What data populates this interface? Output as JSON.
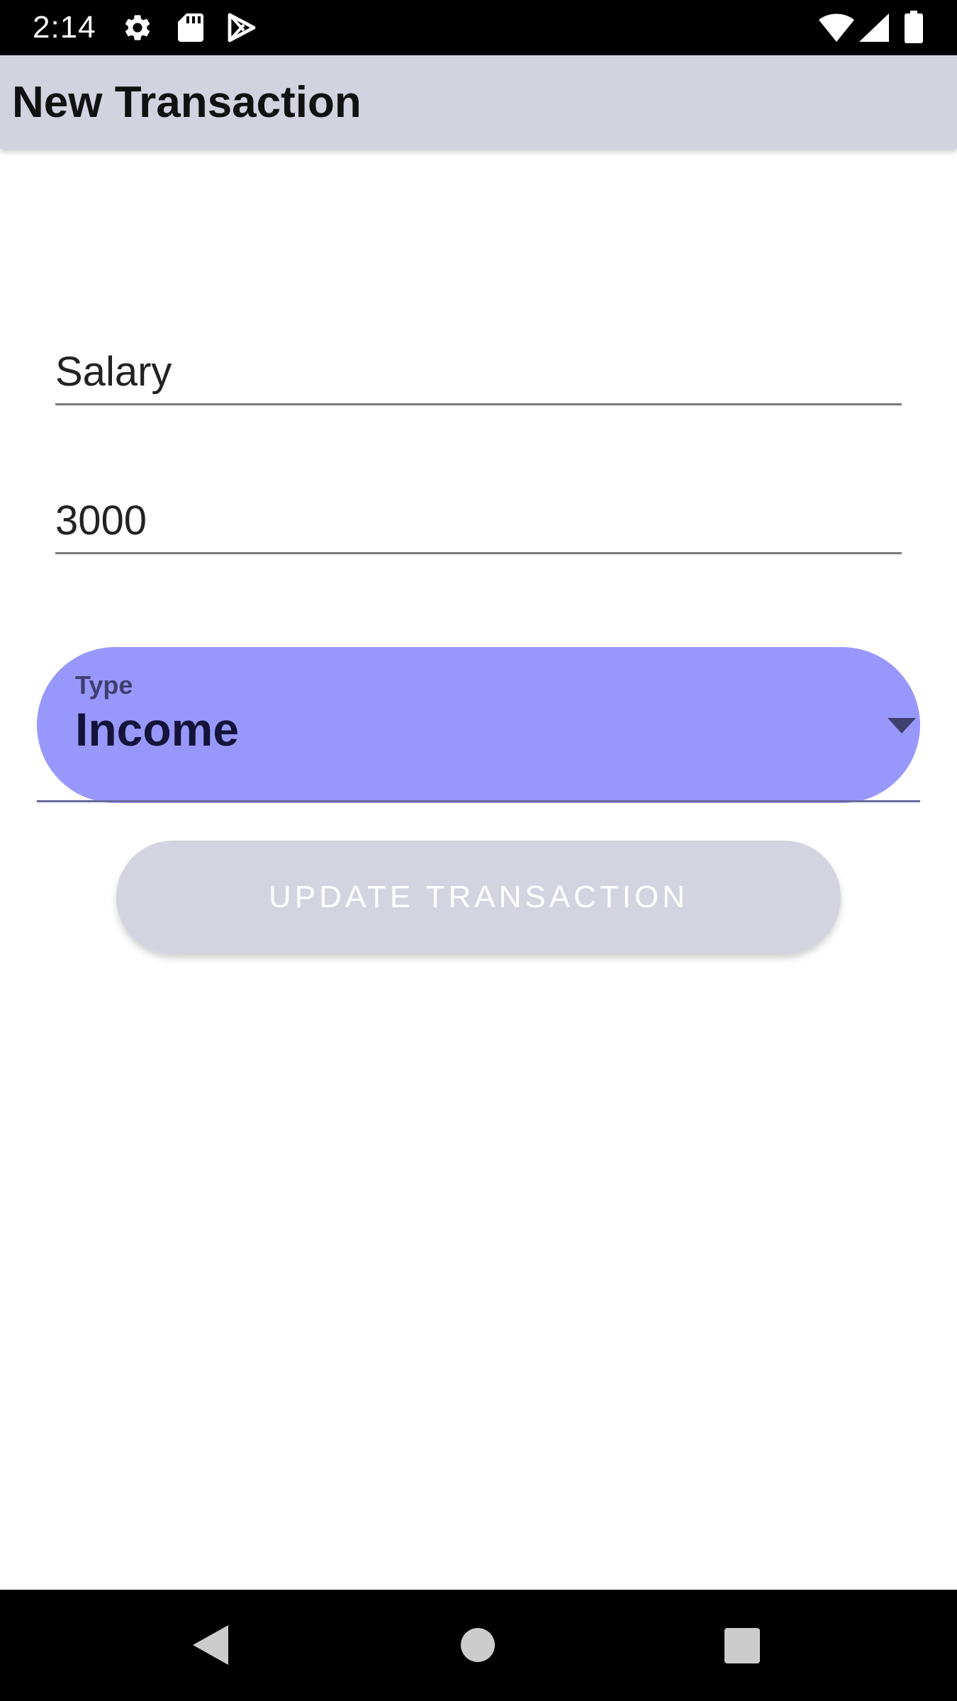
{
  "status_bar": {
    "time": "2:14",
    "icons": [
      "gear-icon",
      "sd-card-icon",
      "play-store-icon",
      "wifi-icon",
      "cell-signal-icon",
      "battery-icon"
    ]
  },
  "app_bar": {
    "title": "New Transaction"
  },
  "form": {
    "description_value": "Salary",
    "amount_value": "3000",
    "type_label": "Type",
    "type_value": "Income",
    "submit_label": "UPDATE TRANSACTION"
  },
  "nav_bar": {
    "icons": [
      "back-icon",
      "home-icon",
      "recents-icon"
    ]
  },
  "colors": {
    "app_bar_bg": "#d3d3e0",
    "spinner_bg": "#9898fc",
    "button_bg_disabled": "#d4d4e0"
  }
}
